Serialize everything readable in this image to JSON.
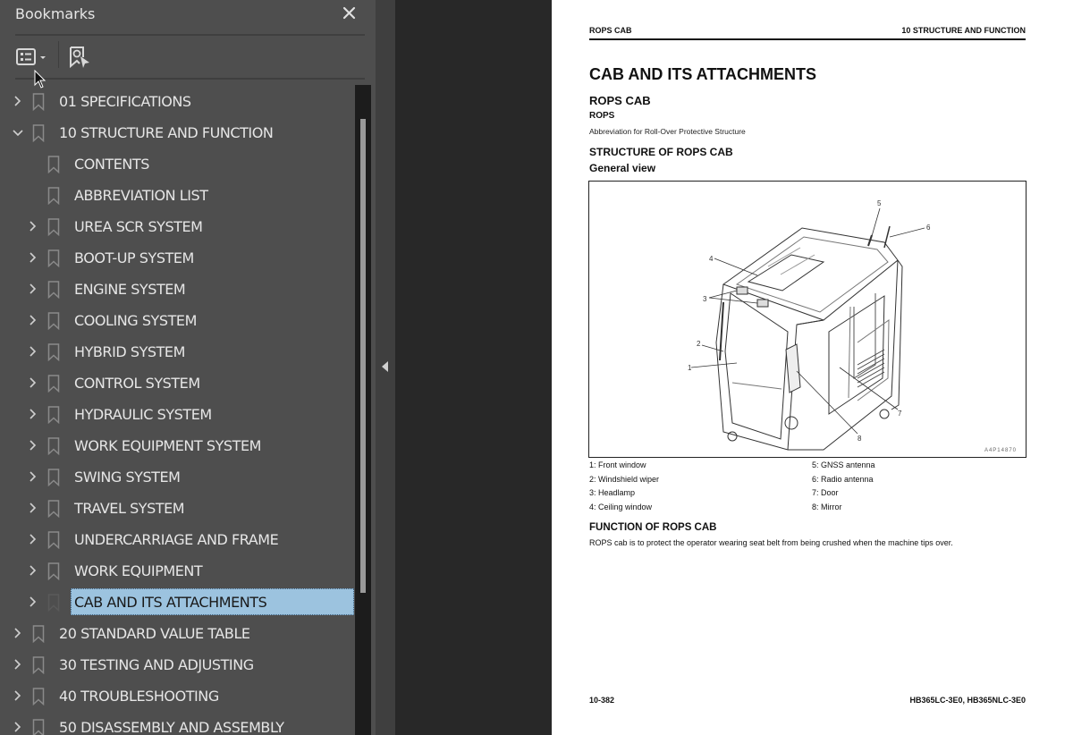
{
  "sidebar": {
    "title": "Bookmarks",
    "close_icon": "close-icon",
    "toolbar": {
      "options_button": "list-options-icon",
      "find_bookmark_button": "find-current-bookmark-icon"
    },
    "items": [
      {
        "label": "01 SPECIFICATIONS",
        "level": 0,
        "expander": "collapsed"
      },
      {
        "label": "10 STRUCTURE AND FUNCTION",
        "level": 0,
        "expander": "expanded"
      },
      {
        "label": "CONTENTS",
        "level": 1,
        "expander": "none"
      },
      {
        "label": "ABBREVIATION LIST",
        "level": 1,
        "expander": "none"
      },
      {
        "label": "UREA SCR SYSTEM",
        "level": 1,
        "expander": "collapsed"
      },
      {
        "label": "BOOT-UP SYSTEM",
        "level": 1,
        "expander": "collapsed"
      },
      {
        "label": "ENGINE SYSTEM",
        "level": 1,
        "expander": "collapsed"
      },
      {
        "label": "COOLING SYSTEM",
        "level": 1,
        "expander": "collapsed"
      },
      {
        "label": "HYBRID SYSTEM",
        "level": 1,
        "expander": "collapsed"
      },
      {
        "label": "CONTROL SYSTEM",
        "level": 1,
        "expander": "collapsed"
      },
      {
        "label": "HYDRAULIC SYSTEM",
        "level": 1,
        "expander": "collapsed"
      },
      {
        "label": "WORK EQUIPMENT SYSTEM",
        "level": 1,
        "expander": "collapsed"
      },
      {
        "label": "SWING SYSTEM",
        "level": 1,
        "expander": "collapsed"
      },
      {
        "label": "TRAVEL SYSTEM",
        "level": 1,
        "expander": "collapsed"
      },
      {
        "label": "UNDERCARRIAGE AND FRAME",
        "level": 1,
        "expander": "collapsed"
      },
      {
        "label": "WORK EQUIPMENT",
        "level": 1,
        "expander": "collapsed"
      },
      {
        "label": "CAB AND ITS ATTACHMENTS",
        "level": 1,
        "expander": "collapsed",
        "selected": true
      },
      {
        "label": "20 STANDARD VALUE TABLE",
        "level": 0,
        "expander": "collapsed"
      },
      {
        "label": "30 TESTING AND ADJUSTING",
        "level": 0,
        "expander": "collapsed"
      },
      {
        "label": "40 TROUBLESHOOTING",
        "level": 0,
        "expander": "collapsed"
      },
      {
        "label": "50 DISASSEMBLY AND ASSEMBLY",
        "level": 0,
        "expander": "collapsed"
      }
    ],
    "selection_color": "#9cc3df"
  },
  "page": {
    "header_left": "ROPS CAB",
    "header_right": "10 STRUCTURE AND FUNCTION",
    "title": "CAB AND ITS ATTACHMENTS",
    "section": "ROPS CAB",
    "term": "ROPS",
    "term_definition": "Abbreviation for Roll-Over Protective Structure",
    "structure_heading": "STRUCTURE OF ROPS CAB",
    "general_view": "General view",
    "figure": {
      "code": "A4P14870",
      "callout_numbers": [
        "1",
        "2",
        "3",
        "4",
        "5",
        "6",
        "7",
        "8"
      ]
    },
    "legend": [
      "1: Front window",
      "2: Windshield wiper",
      "3: Headlamp",
      "4: Ceiling window",
      "5: GNSS antenna",
      "6: Radio antenna",
      "7: Door",
      "8: Mirror"
    ],
    "function_heading": "FUNCTION OF ROPS CAB",
    "function_text": "ROPS cab is to protect the operator wearing seat belt from being crushed when the machine tips over.",
    "footer_left": "10-382",
    "footer_right": "HB365LC-3E0, HB365NLC-3E0"
  }
}
